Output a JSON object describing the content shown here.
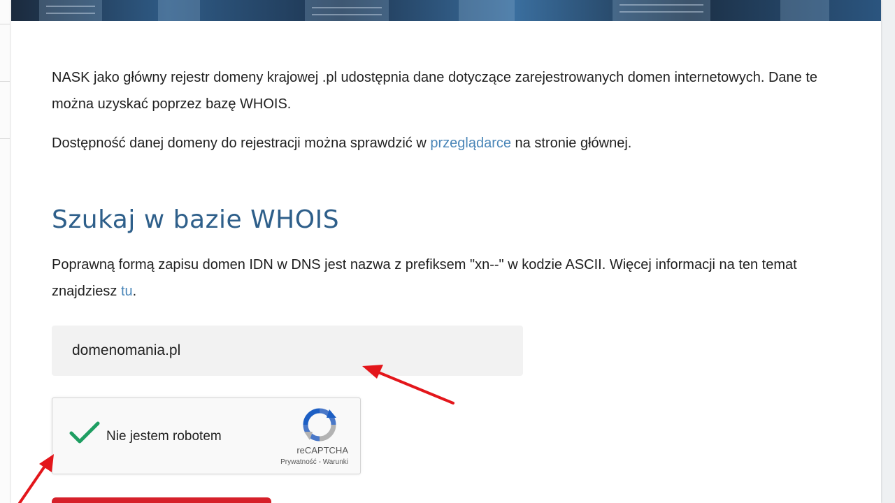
{
  "intro": {
    "paragraph1": "NASK jako główny rejestr domeny krajowej .pl udostępnia dane dotyczące zarejestrowanych domen internetowych. Dane te można uzyskać poprzez bazę WHOIS.",
    "paragraph2_before": "Dostępność danej domeny do rejestracji można sprawdzić w ",
    "paragraph2_link": "przeglądarce",
    "paragraph2_after": " na stronie głównej."
  },
  "whois": {
    "title": "Szukaj w bazie WHOIS",
    "info_before": "Poprawną formą zapisu domen IDN w DNS jest nazwa z prefiksem \"xn--\" w kodzie ASCII. Więcej informacji na ten temat znajdziesz ",
    "info_link": "tu",
    "info_after": ".",
    "domain_value": "domenomania.pl"
  },
  "captcha": {
    "label": "Nie jestem robotem",
    "brand": "reCAPTCHA",
    "terms": "Prywatność - Warunki",
    "check_color": "#1e9e62"
  },
  "colors": {
    "link": "#4a86b8",
    "title": "#2e5f8a",
    "button": "#d6202a",
    "annotation_arrow": "#e3161b"
  }
}
